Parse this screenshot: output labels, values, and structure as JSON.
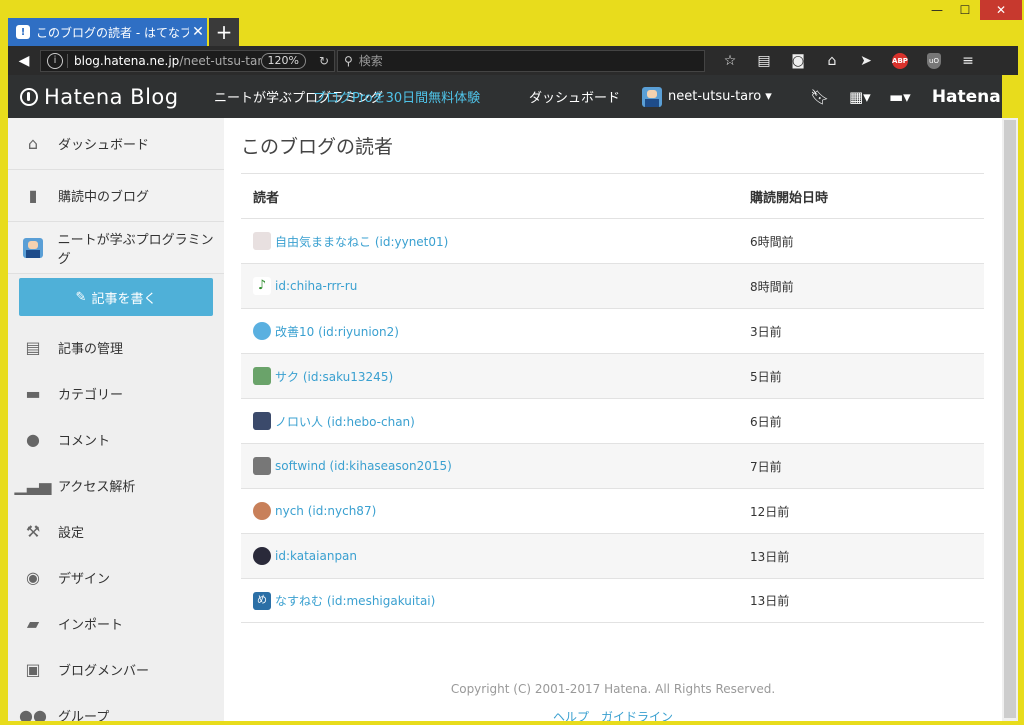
{
  "browser": {
    "tab_title": "このブログの読者 - はてなブログ",
    "tab_close": "✕",
    "new_tab": "+",
    "url_host": "blog.hatena.ne.jp",
    "url_path": "/neet-utsu-taro",
    "zoom": "120%",
    "search_placeholder": "検索",
    "window_min": "—",
    "window_max": "☐",
    "window_close": "✕"
  },
  "header": {
    "logo_text": "Hatena Blog",
    "blog_name": "ニートが学ぶプログラミング",
    "pro_link": "ブログProを30日間無料体験",
    "dashboard": "ダッシュボード",
    "username": "neet-utsu-taro ▾",
    "brand": "Hatena"
  },
  "sidebar": {
    "items": [
      {
        "label": "ダッシュボード"
      },
      {
        "label": "購読中のブログ"
      },
      {
        "label": "ニートが学ぶプログラミング"
      }
    ],
    "write_button": "記事を書く",
    "menu": [
      {
        "label": "記事の管理"
      },
      {
        "label": "カテゴリー"
      },
      {
        "label": "コメント"
      },
      {
        "label": "アクセス解析"
      },
      {
        "label": "設定"
      },
      {
        "label": "デザイン"
      },
      {
        "label": "インポート"
      },
      {
        "label": "ブログメンバー"
      },
      {
        "label": "グループ"
      }
    ]
  },
  "main": {
    "title": "このブログの読者",
    "col_reader": "読者",
    "col_since": "購読開始日時",
    "readers": [
      {
        "name": "自由気ままなねこ (id:yynet01)",
        "since": "6時間前",
        "color": "#e8e0e0"
      },
      {
        "name": "id:chiha-rrr-ru",
        "since": "8時間前",
        "color": "#ffffff"
      },
      {
        "name": "改善10 (id:riyunion2)",
        "since": "3日前",
        "color": "#5ab0e0"
      },
      {
        "name": "サク (id:saku13245)",
        "since": "5日前",
        "color": "#6aa36a"
      },
      {
        "name": "ノロい人 (id:hebo-chan)",
        "since": "6日前",
        "color": "#3b4a6b"
      },
      {
        "name": "softwind (id:kihaseason2015)",
        "since": "7日前",
        "color": "#777777"
      },
      {
        "name": "nych (id:nych87)",
        "since": "12日前",
        "color": "#c8805a"
      },
      {
        "name": "id:kataianpan",
        "since": "13日前",
        "color": "#2a2a3a"
      },
      {
        "name": "なすねむ (id:meshigakuitai)",
        "since": "13日前",
        "color": "#2b6fa6"
      }
    ],
    "copyright": "Copyright (C) 2001-2017 Hatena. All Rights Reserved.",
    "footer_links": "ヘルプ　ガイドライン"
  }
}
